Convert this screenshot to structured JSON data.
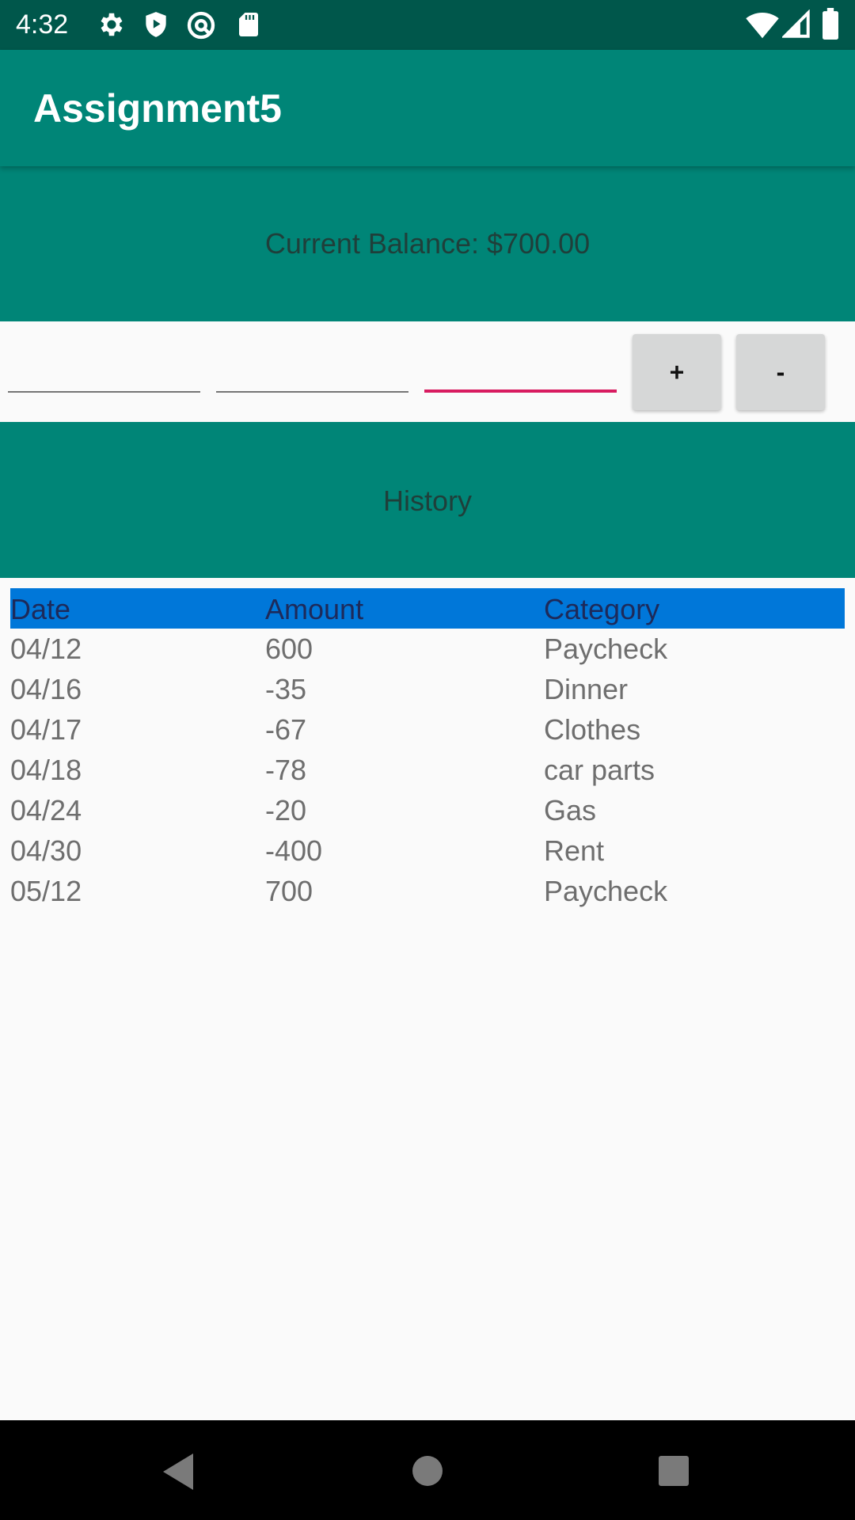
{
  "status_bar": {
    "time": "4:32",
    "left_icons": [
      "gear-icon",
      "shield-play-icon",
      "at-sign-icon",
      "sd-card-icon"
    ],
    "right_icons": [
      "wifi-icon",
      "signal-icon",
      "battery-icon"
    ]
  },
  "app_bar": {
    "title": "Assignment5"
  },
  "balance": {
    "label": "Current Balance: $700.00"
  },
  "inputs": {
    "fields": [
      {
        "value": "",
        "placeholder": ""
      },
      {
        "value": "",
        "placeholder": ""
      },
      {
        "value": "",
        "placeholder": "",
        "focused": true
      }
    ],
    "plus_label": "+",
    "minus_label": "-"
  },
  "history": {
    "label": "History",
    "columns": [
      "Date",
      "Amount",
      "Category"
    ],
    "rows": [
      {
        "date": "04/12",
        "amount": "600",
        "category": "Paycheck"
      },
      {
        "date": "04/16",
        "amount": "-35",
        "category": "Dinner"
      },
      {
        "date": "04/17",
        "amount": "-67",
        "category": "Clothes"
      },
      {
        "date": "04/18",
        "amount": "-78",
        "category": "car parts"
      },
      {
        "date": "04/24",
        "amount": "-20",
        "category": "Gas"
      },
      {
        "date": "04/30",
        "amount": "-400",
        "category": "Rent"
      },
      {
        "date": "05/12",
        "amount": "700",
        "category": "Paycheck"
      }
    ]
  },
  "nav_bar": {
    "buttons": [
      "back-icon",
      "home-icon",
      "recents-icon"
    ]
  },
  "colors": {
    "primary": "#008577",
    "primary_dark": "#00574b",
    "accent": "#d81b60",
    "header_highlight": "#0077d9"
  }
}
